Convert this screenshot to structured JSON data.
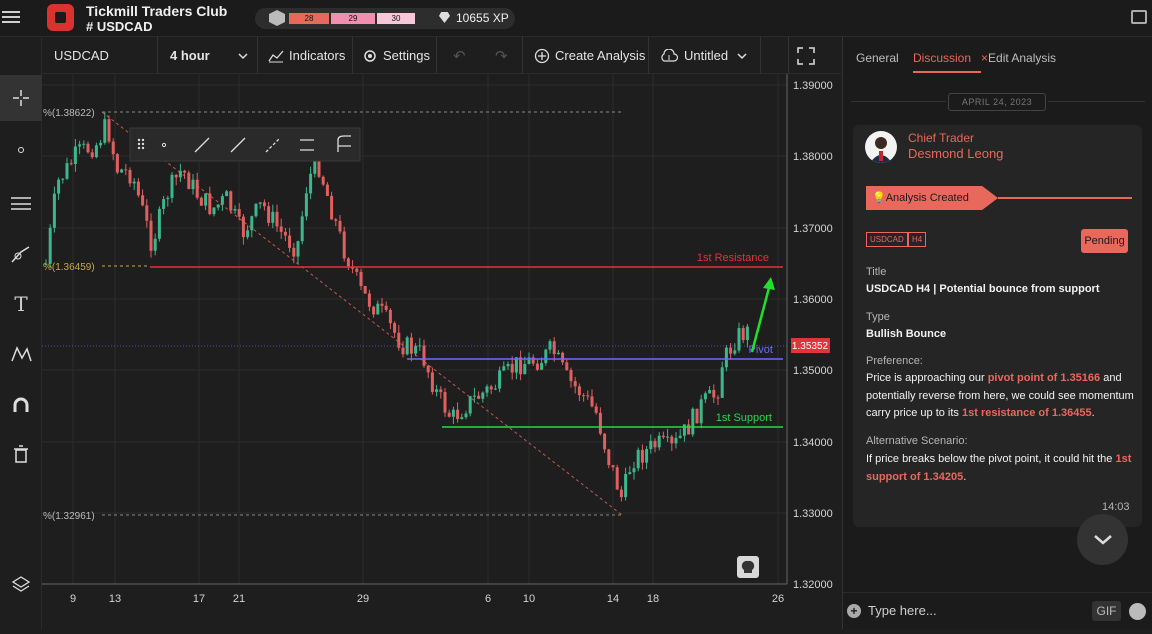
{
  "app": {
    "title": "Tickmill Traders Club",
    "channel": "USDCAD"
  },
  "xp": {
    "levels": [
      "28",
      "29",
      "30"
    ],
    "points": "10655 XP"
  },
  "toolbar": {
    "symbol": "USDCAD",
    "timeframe": "4 hour",
    "indicators": "Indicators",
    "settings": "Settings",
    "create_analysis": "Create Analysis",
    "layout_name": "Untitled"
  },
  "chart": {
    "price_ticks": [
      "1.39000",
      "1.38000",
      "1.37000",
      "1.36000",
      "1.35000",
      "1.34000",
      "1.33000",
      "1.32000"
    ],
    "date_ticks": [
      "9",
      "13",
      "17",
      "21",
      "29",
      "6",
      "10",
      "14",
      "18",
      "26"
    ],
    "current_price": "1.35352",
    "fib_labels": [
      "%(1.38622)",
      "%(1.36459)",
      "%(1.32961)"
    ],
    "levels": {
      "resistance": "1st Resistance",
      "pivot": "Pivot",
      "support": "1st Support"
    },
    "colors": {
      "resistance": "#e0333a",
      "pivot": "#6b6bff",
      "support": "#2bd64b",
      "arrow": "#21e02b",
      "bull": "#3cb68a",
      "bear": "#e06060"
    }
  },
  "right_panel": {
    "tabs": [
      "General",
      "Discussion",
      "Edit Analysis"
    ],
    "date": "APRIL 24, 2023",
    "poster_role": "Chief Trader",
    "poster_name": "Desmond Leong",
    "banner": "Analysis Created",
    "tags": [
      "USDCAD",
      "H4"
    ],
    "status": "Pending",
    "title_label": "Title",
    "title_value": "USDCAD H4 | Potential bounce from support",
    "type_label": "Type",
    "type_value": "Bullish Bounce",
    "preference_label": "Preference:",
    "preference": {
      "t1": "Price is approaching our ",
      "h1": "pivot point of 1.35166",
      "t2": " and potentially reverse from here, we could see momentum carry price up to its ",
      "h2": "1st resistance of 1.36455",
      "t3": "."
    },
    "alt_label": "Alternative Scenario:",
    "alt": {
      "t1": "If price breaks below the pivot point, it could hit the ",
      "h1": "1st support of 1.34205",
      "t2": "."
    },
    "time": "14:03",
    "input_placeholder": "Type here...",
    "gif_label": "GIF"
  }
}
